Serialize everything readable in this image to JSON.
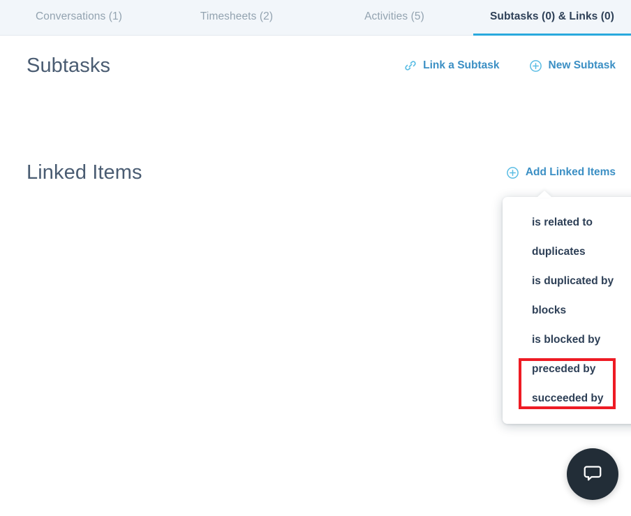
{
  "tabs": [
    {
      "label": "Conversations (1)",
      "active": false
    },
    {
      "label": "Timesheets (2)",
      "active": false
    },
    {
      "label": "Activities (5)",
      "active": false
    },
    {
      "label": "Subtasks (0) & Links (0)",
      "active": true
    }
  ],
  "subtasks_section": {
    "title": "Subtasks",
    "actions": [
      {
        "label": "Link a Subtask",
        "icon": "link-icon"
      },
      {
        "label": "New Subtask",
        "icon": "plus-circle-icon"
      }
    ]
  },
  "linked_items_section": {
    "title": "Linked Items",
    "actions": [
      {
        "label": "Add Linked Items",
        "icon": "plus-circle-icon"
      }
    ]
  },
  "link_type_dropdown": {
    "items": [
      {
        "label": "is related to"
      },
      {
        "label": "duplicates"
      },
      {
        "label": "is duplicated by"
      },
      {
        "label": "blocks"
      },
      {
        "label": "is blocked by"
      },
      {
        "label": "preceded by"
      },
      {
        "label": "succeeded by"
      }
    ]
  },
  "annotation": {
    "color": "#ee1b24",
    "highlights": [
      "preceded by",
      "succeeded by"
    ]
  },
  "chat_widget": {
    "icon": "chat-bubble-icon"
  },
  "colors": {
    "accent": "#29a9dd",
    "link": "#3b8fc4",
    "icon_blue": "#5bbde4",
    "heading": "#4a5c72",
    "tab_active_text": "#2e4057",
    "tab_inactive_text": "#93a3b0",
    "tabbar_bg": "#f2f6fa",
    "dropdown_text": "#2d3f56",
    "chat_bg": "#222d37"
  }
}
